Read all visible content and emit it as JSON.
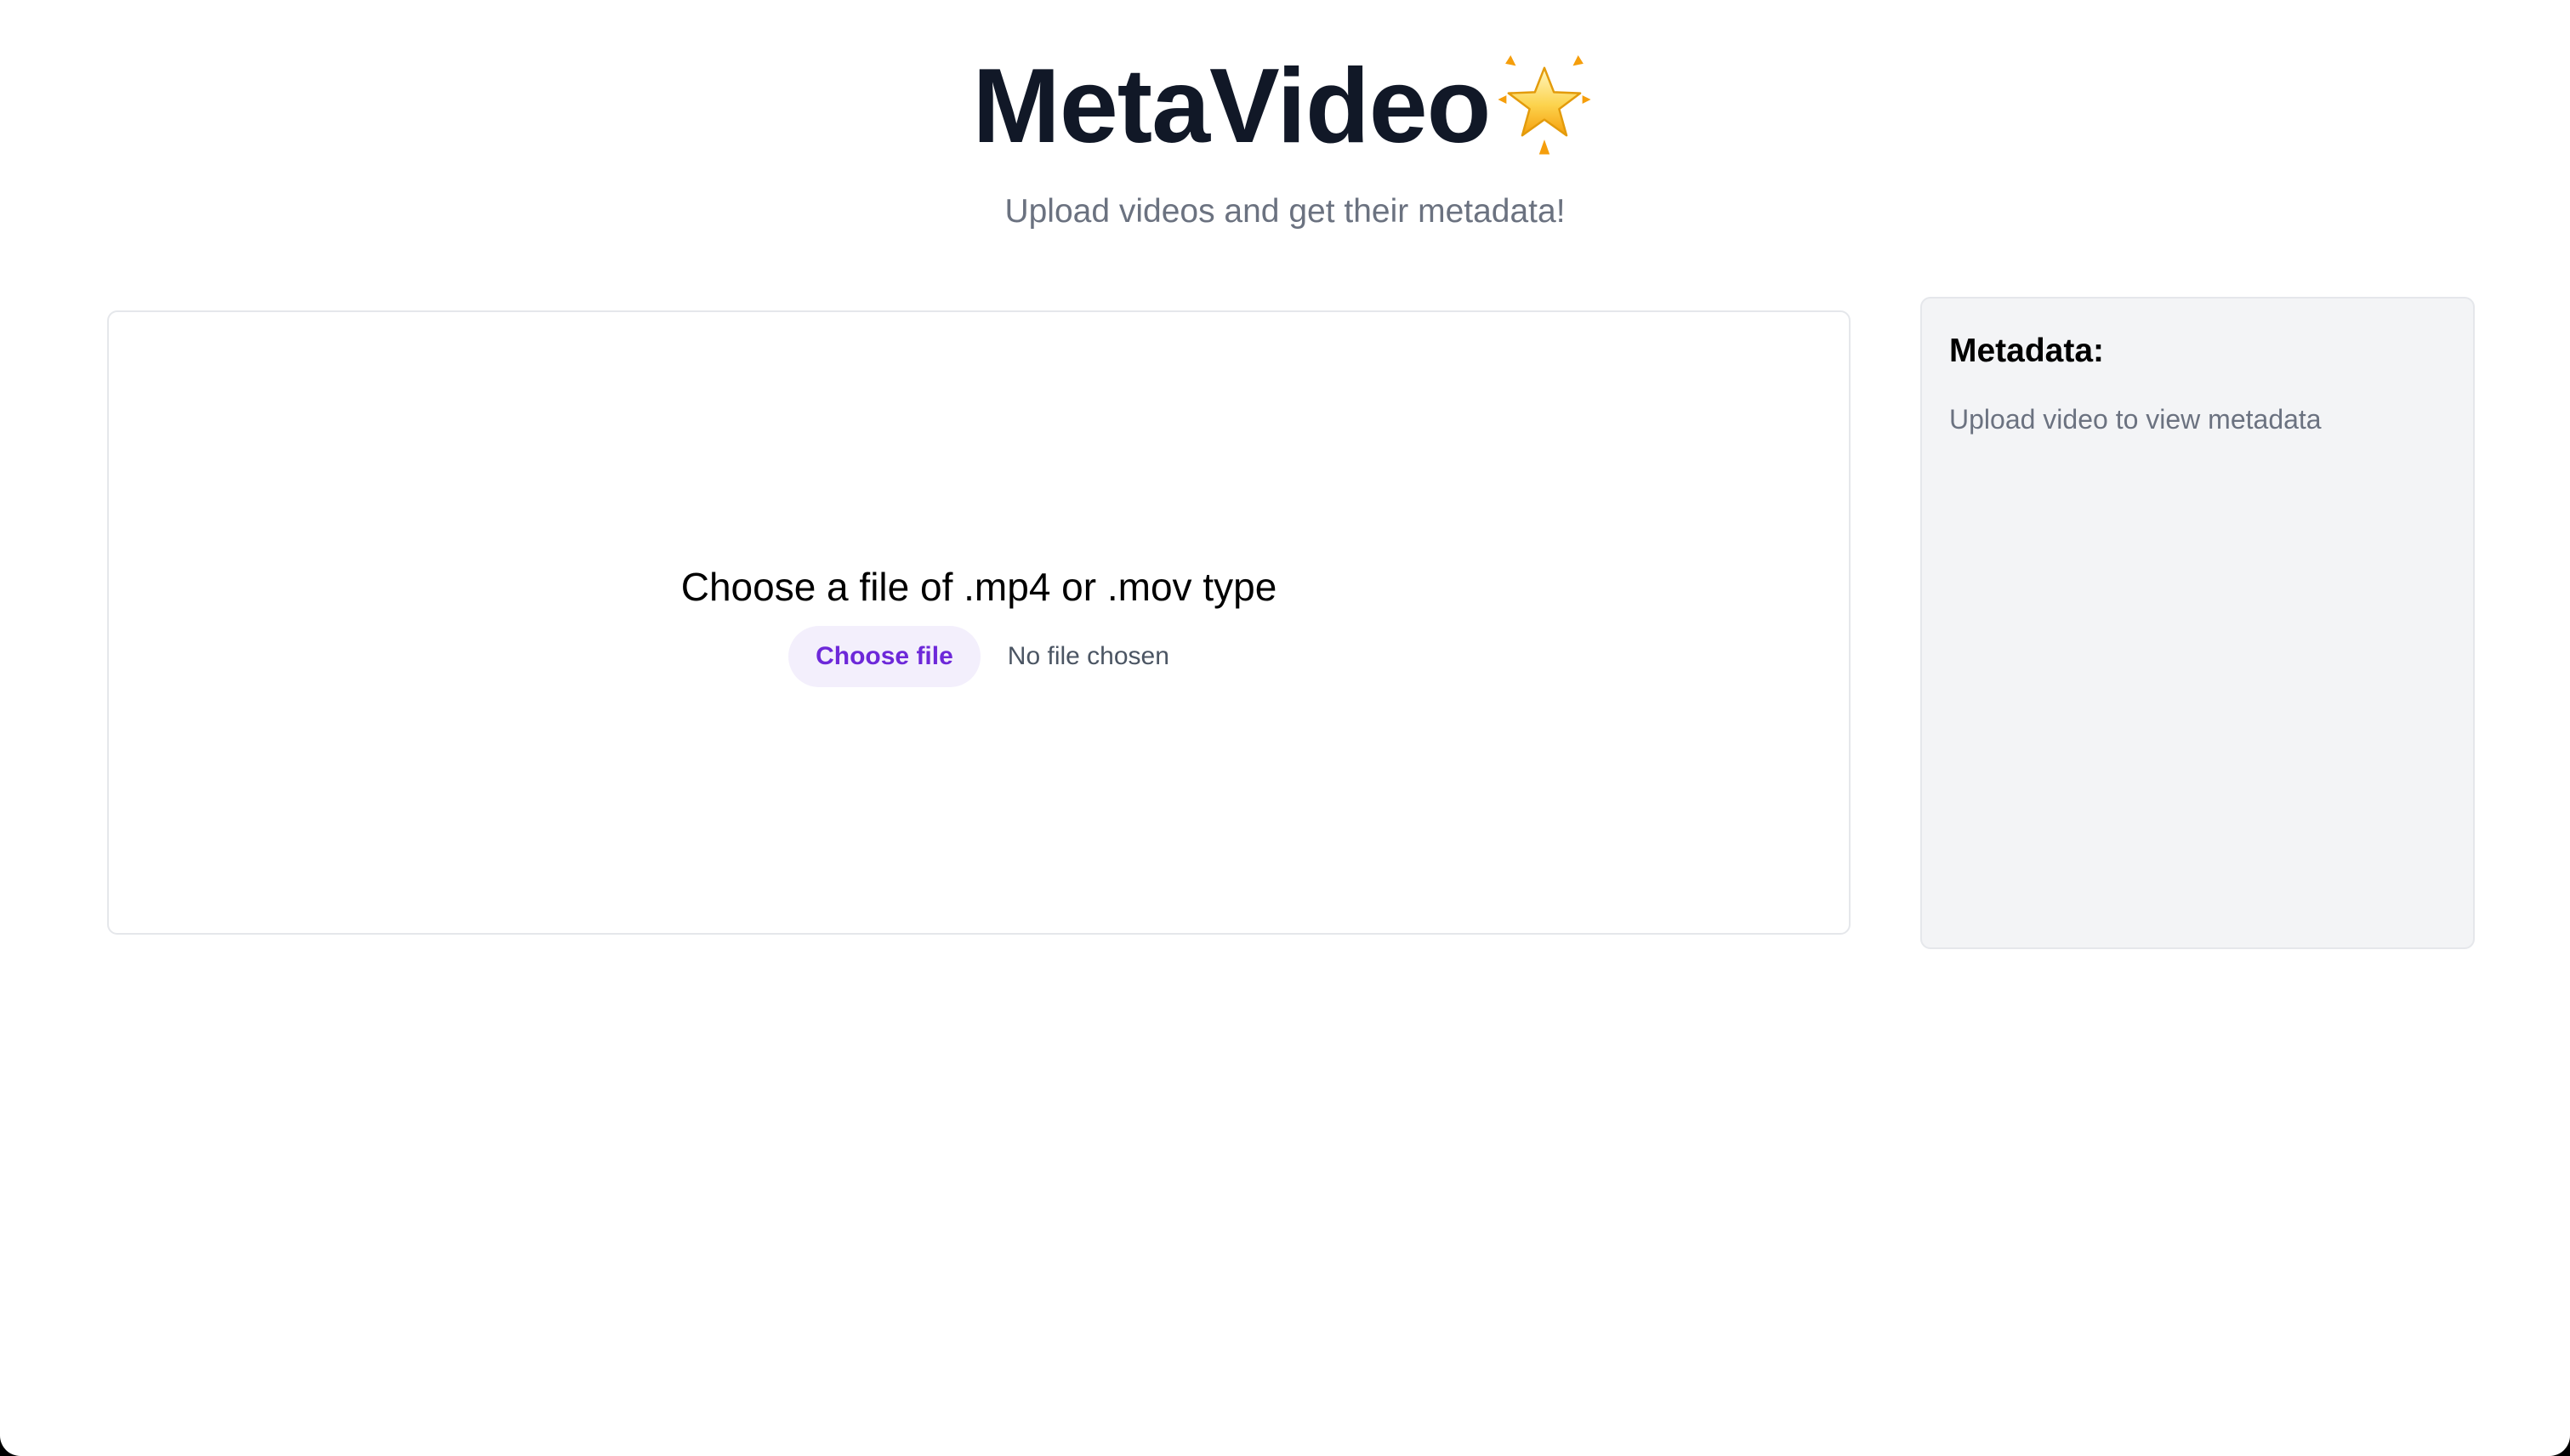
{
  "header": {
    "title": "MetaVideo",
    "title_icon": "glowing-star-icon",
    "subtitle": "Upload videos and get their metadata!"
  },
  "upload": {
    "prompt": "Choose a file of .mp4 or .mov type",
    "button_label": "Choose file",
    "file_status": "No file chosen"
  },
  "metadata": {
    "title": "Metadata:",
    "empty_message": "Upload video to view metadata"
  },
  "colors": {
    "title_text": "#111827",
    "subtitle_text": "#6b7280",
    "button_bg": "#f3effc",
    "button_text": "#6d28d9",
    "panel_border": "#e5e7eb",
    "metadata_bg": "#f3f4f6"
  }
}
